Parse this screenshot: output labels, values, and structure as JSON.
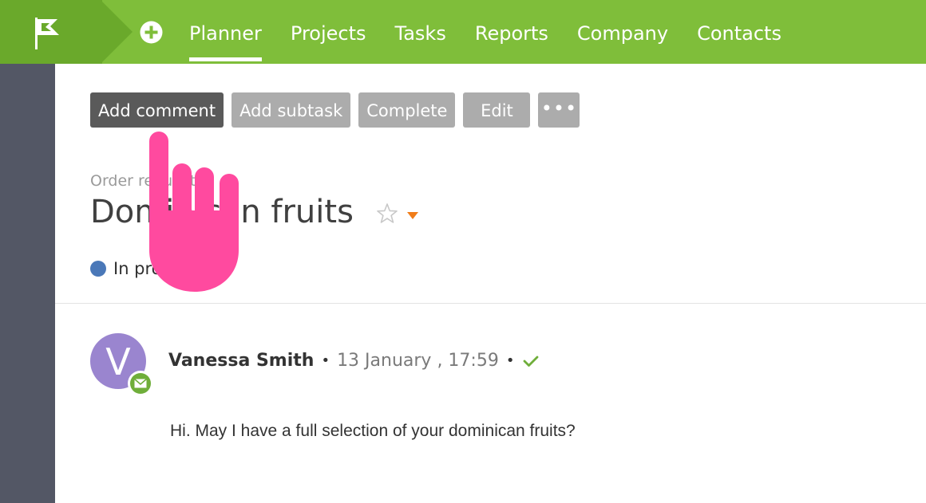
{
  "topbar": {
    "logo": "flag-logo",
    "add_icon": "plus-circle-icon",
    "nav": [
      {
        "label": "Planner",
        "active": true
      },
      {
        "label": "Projects",
        "active": false
      },
      {
        "label": "Tasks",
        "active": false
      },
      {
        "label": "Reports",
        "active": false
      },
      {
        "label": "Company",
        "active": false
      },
      {
        "label": "Contacts",
        "active": false
      }
    ]
  },
  "toolbar": {
    "add_comment": "Add comment",
    "add_subtask": "Add subtask",
    "complete": "Complete",
    "edit": "Edit",
    "more": "•••"
  },
  "task": {
    "breadcrumb": "Order requests",
    "title": "Dominican fruits",
    "star_icon": "star-outline-icon",
    "dropdown_icon": "caret-down-icon",
    "status": "In progress",
    "status_color": "#4a78b8"
  },
  "comment": {
    "avatar_letter": "V",
    "avatar_color": "#9a85cf",
    "badge_icon": "mail-icon",
    "author": "Vanessa Smith",
    "timestamp": "13 January , 17:59",
    "check_icon": "check-icon",
    "body": "Hi. May I have a full selection of your dominican fruits?"
  },
  "colors": {
    "topbar": "#7fbe3a",
    "logo_block": "#6aa92b",
    "sidebar": "#535765",
    "primary_button": "#5a5a5a",
    "secondary_button": "#acacac",
    "hand_pointer": "#ff4a9f"
  },
  "overlay": {
    "icon": "hand-pointer-icon"
  }
}
